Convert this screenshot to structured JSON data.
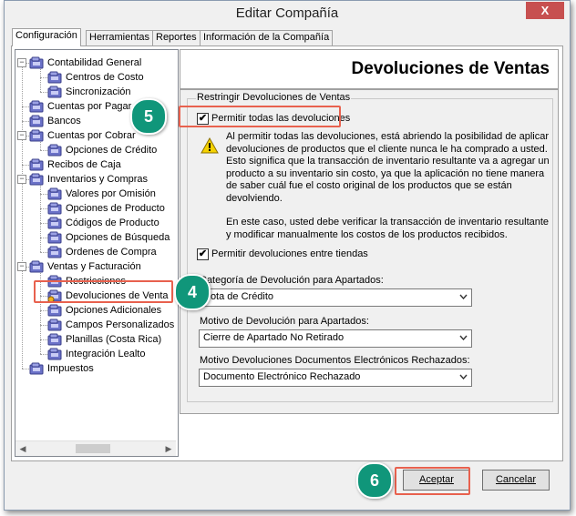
{
  "window": {
    "title": "Editar Compañía",
    "close_glyph": "X"
  },
  "tabs": [
    {
      "label": "Configuración"
    },
    {
      "label": "Herramientas"
    },
    {
      "label": "Reportes"
    },
    {
      "label": "Información de la Compañía"
    }
  ],
  "tree": {
    "expander_glyph": "−",
    "items": [
      {
        "label": "Contabilidad General"
      },
      {
        "label": "Centros de Costo"
      },
      {
        "label": "Sincronización"
      },
      {
        "label": "Cuentas por Pagar"
      },
      {
        "label": "Bancos"
      },
      {
        "label": "Cuentas por Cobrar"
      },
      {
        "label": "Opciones de Crédito"
      },
      {
        "label": "Recibos de Caja"
      },
      {
        "label": "Inventarios y Compras"
      },
      {
        "label": "Valores por Omisión"
      },
      {
        "label": "Opciones de Producto"
      },
      {
        "label": "Códigos de Producto"
      },
      {
        "label": "Opciones de Búsqueda"
      },
      {
        "label": "Ordenes de Compra"
      },
      {
        "label": "Ventas y Facturación"
      },
      {
        "label": "Restricciones"
      },
      {
        "label": "Devoluciones de Venta"
      },
      {
        "label": "Opciones Adicionales"
      },
      {
        "label": "Campos Personalizados"
      },
      {
        "label": "Planillas (Costa Rica)"
      },
      {
        "label": "Integración Lealto"
      },
      {
        "label": "Impuestos"
      }
    ]
  },
  "panel": {
    "header_title": "Devoluciones de Ventas",
    "group_title": "Restringir Devoluciones de Ventas",
    "allow_all_label": "Permitir todas las devoluciones",
    "allow_all_checked": true,
    "warning_text_1": "Al permitir todas las devoluciones, está abriendo la posibilidad de aplicar devoluciones de productos que el cliente nunca le ha comprado a usted. Esto significa que la transacción de inventario resultante va a agregar un producto a su inventario sin costo, ya que la aplicación no tiene manera de saber cuál fue el costo original de los productos que se están devolviendo.",
    "warning_text_2": "En este caso, usted debe verificar la transacción de inventario resultante y modificar manualmente los costos de los productos recibidos.",
    "between_stores_label": "Permitir devoluciones entre tiendas",
    "between_stores_checked": true,
    "category_label": "Categoría de Devolución para Apartados:",
    "category_value": "Nota de Crédito",
    "reason_label": "Motivo de Devolución para Apartados:",
    "reason_value": "Cierre de Apartado No Retirado",
    "einvoice_label": "Motivo Devoluciones Documentos Electrónicos Rechazados:",
    "einvoice_value": "Documento Electrónico Rechazado"
  },
  "buttons": {
    "accept": "Aceptar",
    "cancel": "Cancelar"
  },
  "callouts": {
    "step4": "4",
    "step5": "5",
    "step6": "6"
  },
  "colors": {
    "badge": "#10967a",
    "highlight": "#e8614e",
    "close": "#c75050"
  }
}
